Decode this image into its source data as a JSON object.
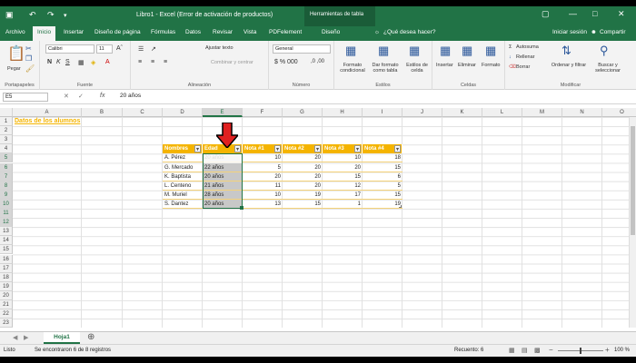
{
  "window": {
    "title": "Libro1 - Excel (Error de activación de productos)",
    "tool_tab": "Herramientas de tabla",
    "sign_in": "Iniciar sesión",
    "share": "Compartir"
  },
  "tabs": [
    {
      "label": "Archivo"
    },
    {
      "label": "Inicio"
    },
    {
      "label": "Insertar"
    },
    {
      "label": "Diseño de página"
    },
    {
      "label": "Fórmulas"
    },
    {
      "label": "Datos"
    },
    {
      "label": "Revisar"
    },
    {
      "label": "Vista"
    },
    {
      "label": "PDFelement"
    },
    {
      "label": "Diseño"
    }
  ],
  "tell_me": "¿Qué desea hacer?",
  "ribbon": {
    "paste": "Pegar",
    "clipboard": "Portapapeles",
    "font_name": "Calibri",
    "font_size": "11",
    "font_group": "Fuente",
    "wrap_text": "Ajustar texto",
    "merge_center": "Combinar y centrar",
    "alignment_group": "Alineación",
    "number_format": "General",
    "number_group": "Número",
    "conditional_format": "Formato condicional",
    "format_table": "Dar formato como tabla",
    "cell_styles": "Estilos de celda",
    "styles_group": "Estilos",
    "insert": "Insertar",
    "delete": "Eliminar",
    "format": "Formato",
    "cells_group": "Celdas",
    "autosum": "Autosuma",
    "fill": "Rellenar",
    "clear": "Borrar",
    "sort_filter": "Ordenar y filtrar",
    "find_select": "Buscar y seleccionar",
    "editing_group": "Modificar"
  },
  "formula_bar": {
    "name_box": "E5",
    "fx": "fx",
    "value": "20 años"
  },
  "columns": [
    "A",
    "B",
    "C",
    "D",
    "E",
    "F",
    "G",
    "H",
    "I",
    "J",
    "K",
    "L",
    "M",
    "N",
    "O"
  ],
  "rows": [
    "1",
    "2",
    "3",
    "4",
    "5",
    "6",
    "7",
    "8",
    "9",
    "10",
    "11",
    "12",
    "13",
    "14",
    "15",
    "16",
    "17",
    "18",
    "19",
    "20",
    "21",
    "22",
    "23"
  ],
  "sheet": {
    "title": "Datos de los alumnos",
    "headers": [
      "Nombres",
      "Edad",
      "Nota #1",
      "Nota #2",
      "Nota #3",
      "Nota #4"
    ],
    "data": [
      [
        "A. Pérez",
        "20 años",
        "10",
        "20",
        "10",
        "18"
      ],
      [
        "G. Mercado",
        "22 años",
        "5",
        "20",
        "20",
        "15"
      ],
      [
        "K. Baptista",
        "20 años",
        "20",
        "20",
        "15",
        "6"
      ],
      [
        "L. Centeno",
        "21 años",
        "11",
        "20",
        "12",
        "5"
      ],
      [
        "M. Muriel",
        "28 años",
        "10",
        "19",
        "17",
        "15"
      ],
      [
        "S. Dantez",
        "20 años",
        "13",
        "15",
        "1",
        "19"
      ]
    ]
  },
  "sheet_tab": "Hoja1",
  "status": {
    "ready": "Listo",
    "found": "Se encontraron 6 de 8 registros",
    "count": "Recuento: 6",
    "zoom": "100 %"
  },
  "colors": {
    "excel_green": "#217346",
    "table_header": "#f4b400",
    "arrow": "#e02020"
  }
}
